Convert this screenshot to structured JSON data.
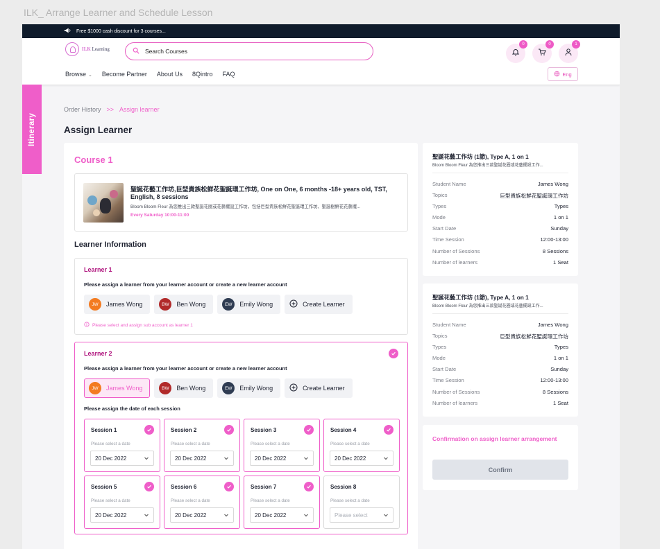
{
  "frame_title": "ILK_ Arrange Learner and Schedule Lesson",
  "promo": {
    "text": "Free $1000 cash discount for 3 courses..."
  },
  "logo": {
    "text_brand": "ILK",
    "text_rest": " Learning"
  },
  "search": {
    "placeholder": "Search Courses"
  },
  "header_icons": {
    "notifications_count": "0",
    "cart_count": "0",
    "profile_count": "1"
  },
  "menu": {
    "browse": "Browse",
    "become_partner": "Become Partner",
    "about_us": "About Us",
    "intro": "8Qintro",
    "faq": "FAQ"
  },
  "language": "Eng",
  "itinerary_tab": "Itinerary",
  "breadcrumb": {
    "parent": "Order History",
    "separator": ">>",
    "current": "Assign learner"
  },
  "page_title": "Assign Learner",
  "course": {
    "heading": "Course 1",
    "name": "聖誕花藝工作坊,巨型貴族松鮮花聖誕環工作坊, One on One, 6 months -18+ years old, TST, English, 8 sessions",
    "description": "Bloom Bloom Fleur 為您推出三款聖誕花圈或花藝擺設工作坊，包括巨型貴族松鮮花聖誕環工作坊、聖誕樹鮮花花藝擺...",
    "schedule": "Every Saturday 10:00-11:00"
  },
  "learner_info_heading": "Learner Information",
  "learner1": {
    "title": "Learner 1",
    "prompt": "Please assign a learner from your learner account or create a new learner account",
    "hint": "Please select and assign sub account as learner 1"
  },
  "learner2": {
    "title": "Learner 2",
    "prompt": "Please assign a learner from your learner account or create a new learner account",
    "date_prompt": "Please assign the date of each session"
  },
  "learners": [
    {
      "initials": "JW",
      "name": "James Wong"
    },
    {
      "initials": "BW",
      "name": "Ben Wong"
    },
    {
      "initials": "EW",
      "name": "Emily Wong"
    }
  ],
  "create_learner": "Create Learner",
  "session_hint": "Please select a date",
  "sessions": [
    {
      "label": "Session 1",
      "date": "20 Dec 2022"
    },
    {
      "label": "Session 2",
      "date": "20 Dec 2022"
    },
    {
      "label": "Session 3",
      "date": "20 Dec 2022"
    },
    {
      "label": "Session 4",
      "date": "20 Dec 2022"
    },
    {
      "label": "Session 5",
      "date": "20 Dec 2022"
    },
    {
      "label": "Session 6",
      "date": "20 Dec 2022"
    },
    {
      "label": "Session 7",
      "date": "20 Dec 2022"
    },
    {
      "label": "Session 8",
      "placeholder": "Please select"
    }
  ],
  "summary_cards": [
    {
      "title": "聖誕花藝工作坊 (1節), Type A, 1 on 1",
      "subtitle": "Bloom Bloom Fleur 為您推出三款聖誕花圈或花藝擺設工作...",
      "rows": [
        {
          "key": "Student Name",
          "value": "James Wong"
        },
        {
          "key": "Topics",
          "value": "巨型貴族松鮮花聖誕環工作坊"
        },
        {
          "key": "Types",
          "value": "Types"
        },
        {
          "key": "Mode",
          "value": "1 on 1"
        },
        {
          "key": "Start Date",
          "value": "Sunday"
        },
        {
          "key": "Time Session",
          "value": "12:00-13:00"
        },
        {
          "key": "Number of Sessions",
          "value": "8 Sessions"
        },
        {
          "key": "Number of learners",
          "value": "1 Seat"
        }
      ]
    },
    {
      "title": "聖誕花藝工作坊 (1節), Type A, 1 on 1",
      "subtitle": "Bloom Bloom Fleur 為您推出三款聖誕花圈或花藝擺設工作...",
      "rows": [
        {
          "key": "Student Name",
          "value": "James Wong"
        },
        {
          "key": "Topics",
          "value": "巨型貴族松鮮花聖誕環工作坊"
        },
        {
          "key": "Types",
          "value": "Types"
        },
        {
          "key": "Mode",
          "value": "1 on 1"
        },
        {
          "key": "Start Date",
          "value": "Sunday"
        },
        {
          "key": "Time Session",
          "value": "12:00-13:00"
        },
        {
          "key": "Number of Sessions",
          "value": "8 Sessions"
        },
        {
          "key": "Number of learners",
          "value": "1 Seat"
        }
      ]
    }
  ],
  "confirmation": {
    "title": "Confirmation on assign learner arrangement",
    "button": "Confirm"
  },
  "colors": {
    "accent": "#ef5ec9",
    "dark_banner": "#0f1b2b",
    "learner_title": "#b0157e"
  }
}
